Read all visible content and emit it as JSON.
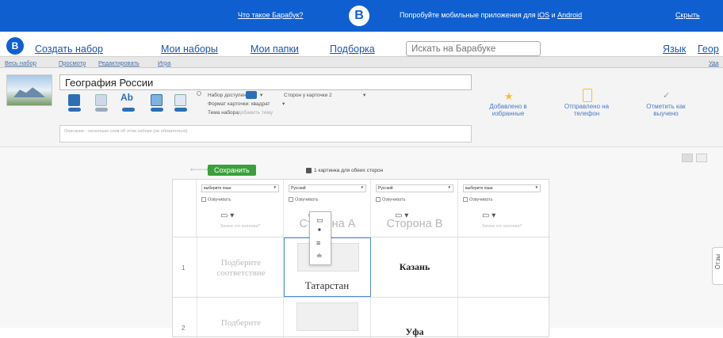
{
  "topbar": {
    "what_is": "Что такое Барабук?",
    "logo_letter": "B",
    "promo_prefix": "Попробуйте мобильные приложения для ",
    "promo_ios": "iOS",
    "promo_and": " и ",
    "promo_android": "Android",
    "hide": "Скрыть"
  },
  "nav": {
    "logo_letter": "B",
    "create_set": "Создать набор",
    "my_sets": "Мои наборы",
    "my_folders": "Мои папки",
    "selection": "Подборка",
    "search_placeholder": "Искать на Барабуке",
    "language": "Язык",
    "geo_partial": "Геор"
  },
  "subnav": {
    "whole_set": "Весь набор",
    "view": "Просмотр",
    "edit": "Редактировать",
    "game": "Игра",
    "right_partial": "Уда"
  },
  "editor": {
    "title": "География России",
    "set_available": "Набор доступен",
    "sides_per_card": "Сторон у карточки 2",
    "card_format": "Формат карточки: квадрат",
    "set_topic": "Тема набора",
    "add_topic": "добавить тему",
    "description_placeholder": "Описание - несколько слов об этом наборе (не обязательно)",
    "added_favorites": "Добавлено в\nизбранные",
    "sent_to_phone": "Отправлено на\nтелефон",
    "mark_learned": "Отметить как\nвыучено"
  },
  "main": {
    "save": "Сохранить",
    "one_picture_both": "1 картинка для обеих сторон",
    "columns": [
      {
        "lang": "выберите язык",
        "voice": "Озвучивать",
        "hint": "Зачем это колонка?"
      },
      {
        "lang": "Русский",
        "voice": "Озвучивать",
        "side": "Сторона А"
      },
      {
        "lang": "Русский",
        "voice": "Озвучивать",
        "side": "Сторона В"
      },
      {
        "lang": "выберите язык",
        "voice": "Озвучивать",
        "hint": "Зачем это колонка?"
      }
    ],
    "rows": [
      {
        "num": "1",
        "placeholder": "Подберите\nсоответствие",
        "side_a": "Татарстан",
        "side_b": "Казань"
      },
      {
        "num": "2",
        "placeholder": "Подберите",
        "side_a": "",
        "side_b": "Уфа"
      }
    ],
    "feedback_tab": "Отзы"
  },
  "colors": {
    "topbar_bg": "#0f5fd0",
    "link": "#1a55b0",
    "save_green": "#3aa13a",
    "tool_icon_blue": "#2d6fb5",
    "favorite_star": "#f2c230",
    "phone_icon": "#f2c230"
  }
}
